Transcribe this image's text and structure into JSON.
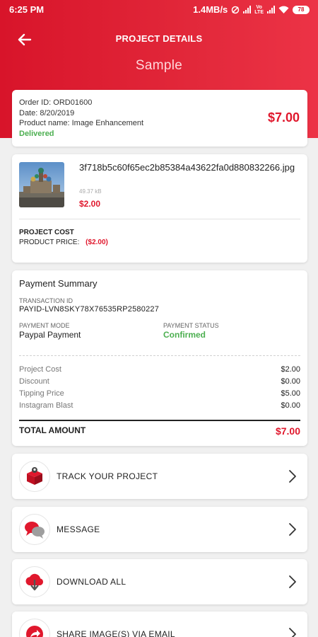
{
  "status_bar": {
    "time": "6:25 PM",
    "speed": "1.4MB/s",
    "volte_top": "Vo",
    "volte_bottom": "LTE",
    "battery": "78"
  },
  "header": {
    "title": "PROJECT DETAILS",
    "subtitle": "Sample"
  },
  "order": {
    "order_id": "Order ID: ORD01600",
    "date": "Date: 8/20/2019",
    "product_name": "Product name: Image Enhancement",
    "status": "Delivered",
    "price": "$7.00"
  },
  "product": {
    "file_name": "3f718b5c60f65ec2b85384a43622fa0d880832266.jpg",
    "file_size": "49.37 kB",
    "price": "$2.00",
    "project_cost_label": "PROJECT COST",
    "product_price_label": "PRODUCT PRICE:",
    "product_price_value": "($2.00)"
  },
  "payment": {
    "title": "Payment Summary",
    "transaction_id_label": "TRANSACTION ID",
    "transaction_id": "PAYID-LVN8SKY78X76535RP2580227",
    "payment_mode_label": "PAYMENT MODE",
    "payment_mode": "Paypal Payment",
    "payment_status_label": "PAYMENT STATUS",
    "payment_status": "Confirmed",
    "items": [
      {
        "label": "Project Cost",
        "value": "$2.00"
      },
      {
        "label": "Discount",
        "value": "$0.00"
      },
      {
        "label": "Tipping Price",
        "value": "$5.00"
      },
      {
        "label": "Instagram Blast",
        "value": "$0.00"
      }
    ],
    "total_label": "TOTAL AMOUNT",
    "total_value": "$7.00"
  },
  "actions": [
    {
      "label": "TRACK YOUR PROJECT",
      "icon": "delivery-box-icon"
    },
    {
      "label": "MESSAGE",
      "icon": "chat-bubbles-icon"
    },
    {
      "label": "DOWNLOAD ALL",
      "icon": "cloud-download-icon"
    },
    {
      "label": "SHARE IMAGE(S) VIA EMAIL",
      "icon": "share-icon"
    }
  ],
  "colors": {
    "brand_red": "#e0182d",
    "success_green": "#4caf50"
  }
}
